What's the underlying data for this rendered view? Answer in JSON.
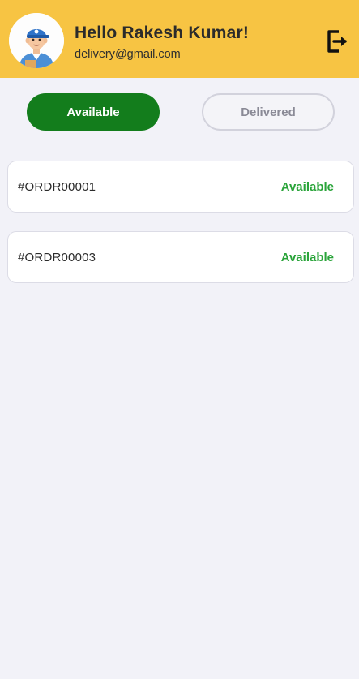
{
  "header": {
    "greeting": "Hello Rakesh Kumar!",
    "email": "delivery@gmail.com",
    "avatar_icon": "delivery-man-avatar",
    "logout_icon": "logout-icon"
  },
  "tabs": [
    {
      "label": "Available",
      "active": true
    },
    {
      "label": "Delivered",
      "active": false
    }
  ],
  "orders": [
    {
      "id": "#ORDR00001",
      "status": "Available"
    },
    {
      "id": "#ORDR00003",
      "status": "Available"
    }
  ],
  "colors": {
    "header_bg": "#f7c443",
    "active_tab": "#137d1c",
    "status_green": "#2aa43a",
    "page_bg": "#f2f2f8"
  }
}
